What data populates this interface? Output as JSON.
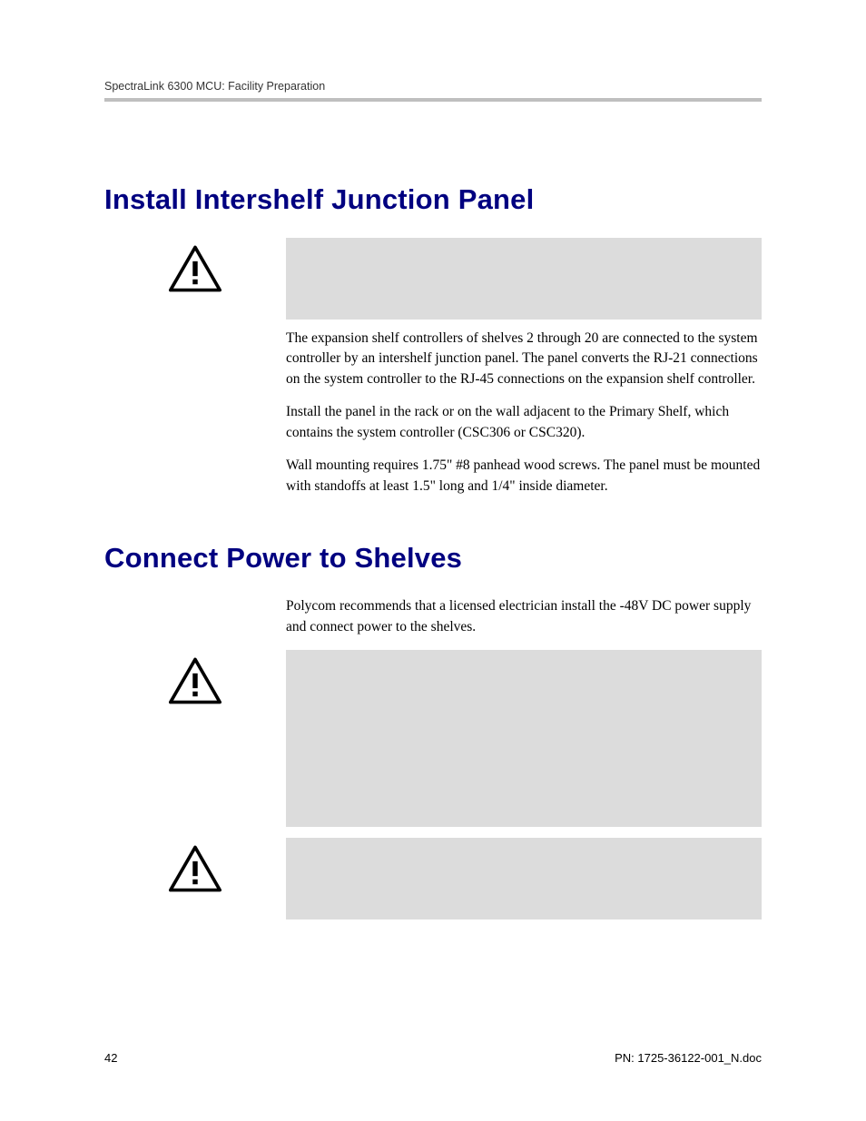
{
  "header": {
    "running_title": "SpectraLink 6300 MCU: Facility Preparation"
  },
  "section1": {
    "heading": "Install Intershelf Junction Panel",
    "paragraphs": [
      "The expansion shelf controllers of shelves 2 through 20 are connected to the system controller by an intershelf junction panel. The panel converts the RJ-21 connections on the system controller to the RJ-45 connections on the expansion shelf controller.",
      "Install the panel in the rack or on the wall adjacent to the Primary Shelf, which contains the system controller (CSC306 or CSC320).",
      "Wall mounting requires 1.75\" #8 panhead wood screws. The panel must be mounted with standoffs at least 1.5\" long and 1/4\" inside diameter."
    ]
  },
  "section2": {
    "heading": "Connect Power to Shelves",
    "paragraphs": [
      "Polycom recommends that a licensed electrician install the -48V DC power supply and connect power to the shelves."
    ]
  },
  "footer": {
    "page_number": "42",
    "doc_id": "PN: 1725-36122-001_N.doc"
  }
}
